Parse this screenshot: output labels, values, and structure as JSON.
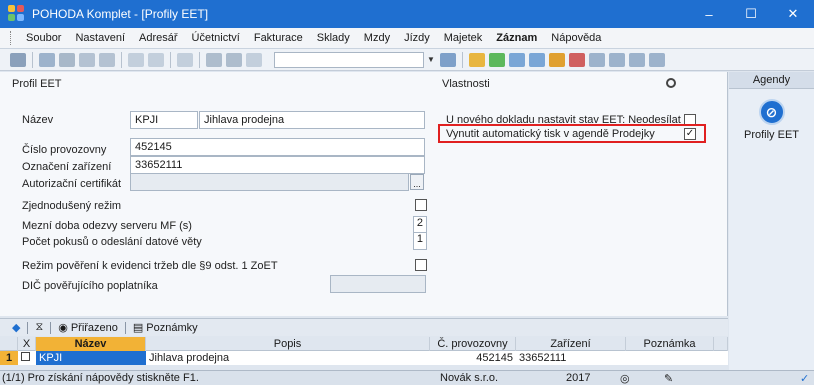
{
  "window": {
    "title": "POHODA Komplet - [Profily EET]",
    "buttons": [
      "–",
      "☐",
      "✕"
    ]
  },
  "menu": [
    {
      "label": "Soubor",
      "bold": false
    },
    {
      "label": "Nastavení",
      "bold": false
    },
    {
      "label": "Adresář",
      "bold": false
    },
    {
      "label": "Účetnictví",
      "bold": false
    },
    {
      "label": "Fakturace",
      "bold": false
    },
    {
      "label": "Sklady",
      "bold": false
    },
    {
      "label": "Mzdy",
      "bold": false
    },
    {
      "label": "Jízdy",
      "bold": false
    },
    {
      "label": "Majetek",
      "bold": false
    },
    {
      "label": "Záznam",
      "bold": true
    },
    {
      "label": "Nápověda",
      "bold": false
    }
  ],
  "profile": {
    "section_title": "Profil EET",
    "name_label": "Název",
    "name_code": "KPJI",
    "name_value": "Jihlava prodejna",
    "provozovna_label": "Číslo provozovny",
    "provozovna_value": "452145",
    "zarizeni_label": "Označení zařízení",
    "zarizeni_value": "33652111",
    "certifikat_label": "Autorizační certifikát",
    "certifikat_btn": "...",
    "zjednoduseny_label": "Zjednodušený režim",
    "doba_label": "Mezní doba odezvy serveru MF (s)",
    "doba_value": "2",
    "pokusy_label": "Počet pokusů o odeslání datové věty",
    "pokusy_value": "1",
    "povereni_label": "Režim pověření k evidenci tržeb dle §9 odst. 1 ZoET",
    "dic_label": "DIČ pověřujícího poplatníka"
  },
  "properties": {
    "section_title": "Vlastnosti",
    "item1": "U nového dokladu nastavit stav EET: Neodesílat",
    "item1_checked": false,
    "item2": "Vynutit automatický tisk v agendě Prodejky",
    "item2_checked": true
  },
  "agenda": {
    "header": "Agendy",
    "item_label": "Profily EET"
  },
  "tabs": {
    "prirazeno": "Přiřazeno",
    "poznamky": "Poznámky"
  },
  "grid": {
    "headers": [
      "X",
      "Název",
      "Popis",
      "Č. provozovny",
      "Zařízení",
      "Poznámka"
    ],
    "rows": [
      {
        "num": "1",
        "nazev": "KPJI",
        "popis": "Jihlava prodejna",
        "provozovna": "452145",
        "zarizeni": "33652111",
        "poznamka": ""
      }
    ]
  },
  "status": {
    "help": "(1/1) Pro získání nápovědy stiskněte F1.",
    "company": "Novák s.r.o.",
    "year": "2017"
  },
  "colors": {
    "titlebar": "#1f6fd0",
    "accent": "#f2b236",
    "highlight": "#e02020"
  }
}
